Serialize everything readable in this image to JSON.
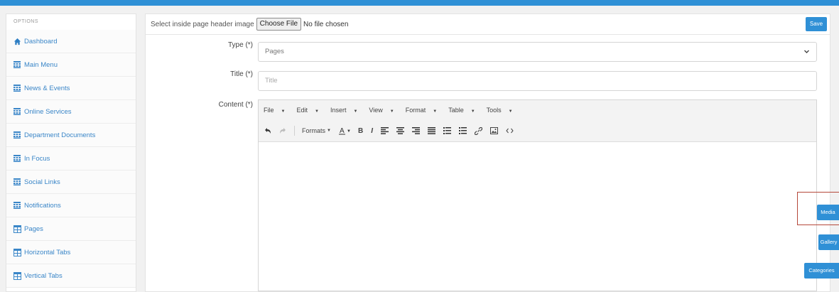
{
  "sidebar": {
    "header": "OPTIONS",
    "items": [
      {
        "label": "Dashboard",
        "icon": "home-icon"
      },
      {
        "label": "Main Menu",
        "icon": "grid-icon"
      },
      {
        "label": "News & Events",
        "icon": "grid-icon"
      },
      {
        "label": "Online Services",
        "icon": "grid-icon"
      },
      {
        "label": "Department Documents",
        "icon": "grid-icon"
      },
      {
        "label": "In Focus",
        "icon": "grid-icon"
      },
      {
        "label": "Social Links",
        "icon": "grid-icon"
      },
      {
        "label": "Notifications",
        "icon": "grid-icon"
      },
      {
        "label": "Pages",
        "icon": "table-icon"
      },
      {
        "label": "Horizontal Tabs",
        "icon": "table-icon"
      },
      {
        "label": "Vertical Tabs",
        "icon": "table-icon"
      }
    ]
  },
  "header": {
    "image_label": "Select inside page header image",
    "choose_file": "Choose File",
    "no_file": "No file chosen",
    "save": "Save"
  },
  "form": {
    "type_label": "Type (*)",
    "type_value": "Pages",
    "title_label": "Title (*)",
    "title_placeholder": "Title",
    "content_label": "Content (*)"
  },
  "editor": {
    "menus": [
      "File",
      "Edit",
      "Insert",
      "View",
      "Format",
      "Table",
      "Tools"
    ],
    "formats_label": "Formats"
  },
  "side_buttons": {
    "media": "Media",
    "gallery": "Gallery",
    "categories": "Categories"
  },
  "colors": {
    "accent": "#2f90d6",
    "highlight_border": "#b5483a"
  }
}
